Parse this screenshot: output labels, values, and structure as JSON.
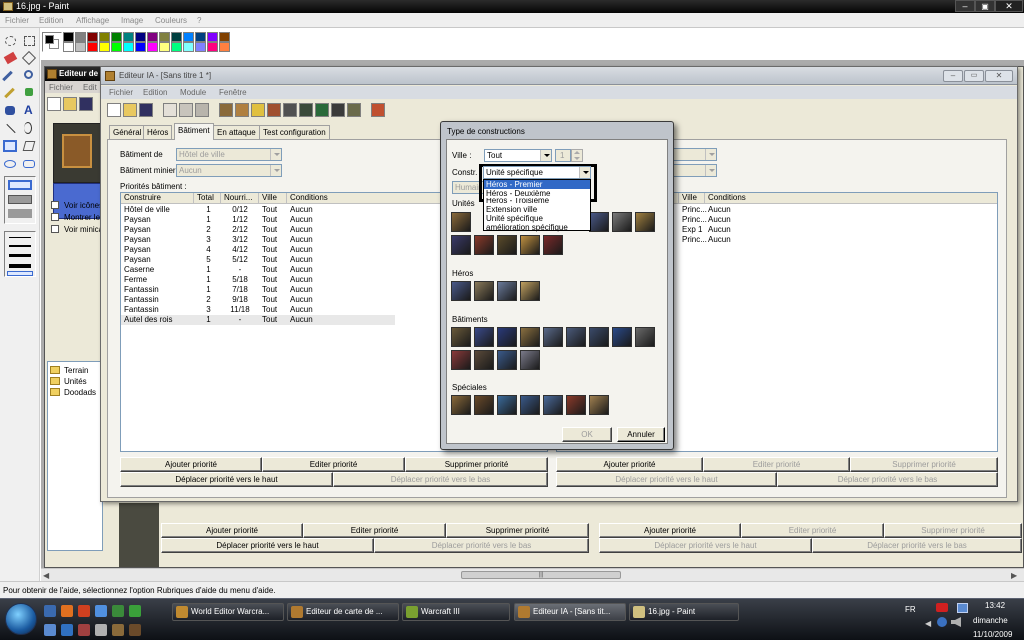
{
  "paint": {
    "title": "16.jpg - Paint",
    "menu": [
      "Fichier",
      "Edition",
      "Affichage",
      "Image",
      "Couleurs",
      "?"
    ],
    "status": "Pour obtenir de l'aide, sélectionnez l'option Rubriques d'aide du menu d'aide.",
    "palette_top": [
      "#000000",
      "#808080",
      "#800000",
      "#808000",
      "#008000",
      "#008080",
      "#000080",
      "#800080",
      "#808040",
      "#004040",
      "#0080ff",
      "#004080",
      "#8000ff",
      "#804000"
    ],
    "palette_bottom": [
      "#ffffff",
      "#c0c0c0",
      "#ff0000",
      "#ffff00",
      "#00ff00",
      "#00ffff",
      "#0000ff",
      "#ff00ff",
      "#ffff80",
      "#00ff80",
      "#80ffff",
      "#8080ff",
      "#ff0080",
      "#ff8040"
    ]
  },
  "editeur_bg": {
    "title": "Editeur de",
    "menu": [
      "Fichier",
      "Edit"
    ],
    "checks": [
      "Voir icônes",
      "Montrer les",
      "Voir minica"
    ],
    "tree": [
      "Terrain",
      "Unités",
      "Doodads"
    ],
    "buttons": {
      "add": "Ajouter priorité",
      "edit": "Editer priorité",
      "del": "Supprimer priorité",
      "up": "Déplacer priorité vers le haut",
      "down": "Déplacer priorité vers le bas"
    }
  },
  "editeur_ia": {
    "title": "Editeur IA - [Sans titre 1 *]",
    "menu": [
      "Fichier",
      "Edition",
      "Module",
      "Fenêtre"
    ],
    "tabs": [
      "Général",
      "Héros",
      "Bâtiment",
      "En attaque",
      "Test configuration"
    ],
    "batiment_de_label": "Bâtiment de",
    "batiment_de_value": "Hôtel de ville",
    "batiment_minier_label": "Bâtiment minier :",
    "batiment_minier_value": "Aucun",
    "priorites_label": "Priorités bâtiment :",
    "columns": [
      "Construire",
      "Total",
      "Nourri...",
      "Ville",
      "Conditions"
    ],
    "rows": [
      [
        "Hôtel de ville",
        "1",
        "0/12",
        "Tout",
        "Aucun"
      ],
      [
        "Paysan",
        "1",
        "1/12",
        "Tout",
        "Aucun"
      ],
      [
        "Paysan",
        "2",
        "2/12",
        "Tout",
        "Aucun"
      ],
      [
        "Paysan",
        "3",
        "3/12",
        "Tout",
        "Aucun"
      ],
      [
        "Paysan",
        "4",
        "4/12",
        "Tout",
        "Aucun"
      ],
      [
        "Paysan",
        "5",
        "5/12",
        "Tout",
        "Aucun"
      ],
      [
        "Caserne",
        "1",
        "-",
        "Tout",
        "Aucun"
      ],
      [
        "Ferme",
        "1",
        "5/18",
        "Tout",
        "Aucun"
      ],
      [
        "Fantassin",
        "1",
        "7/18",
        "Tout",
        "Aucun"
      ],
      [
        "Fantassin",
        "2",
        "9/18",
        "Tout",
        "Aucun"
      ],
      [
        "Fantassin",
        "3",
        "11/18",
        "Tout",
        "Aucun"
      ],
      [
        "Autel des rois",
        "1",
        "-",
        "Tout",
        "Aucun"
      ]
    ],
    "right_columns": [
      "Ville",
      "Conditions"
    ],
    "right_rows": [
      [
        "Princ...",
        "Aucun"
      ],
      [
        "Princ...",
        "Aucun"
      ],
      [
        "Exp 1",
        "Aucun"
      ],
      [
        "Princ...",
        "Aucun"
      ]
    ],
    "buttons": {
      "add": "Ajouter priorité",
      "edit": "Editer priorité",
      "del": "Supprimer priorité",
      "up": "Déplacer priorité vers le haut",
      "down": "Déplacer priorité vers le bas"
    }
  },
  "dialog": {
    "title": "Type de constructions",
    "ville_label": "Ville :",
    "ville_value": "Tout",
    "ville_num": "1",
    "constr_label": "Constr.",
    "constr_value": "Unité spécifique",
    "race_value": "Humain",
    "unites_label": "Unités",
    "dropdown": [
      "Héros - Premier",
      "Héros - Deuxième",
      "Héros - Troisième",
      "Extension ville",
      "Unité spécifique",
      "amélioration spécifique"
    ],
    "sections": {
      "heros": "Héros",
      "batiments": "Bâtiments",
      "speciales": "Spéciales"
    },
    "ok": "OK",
    "annuler": "Annuler",
    "unit_colors": [
      "#8a6a3a",
      "#4a5a8a",
      "#7a7a7a",
      "#a08040",
      "#3a3a6a",
      "#8a3a2a",
      "#5a4a2a",
      "#c09040",
      "#7a2a2a"
    ],
    "hero_colors": [
      "#4a5a8a",
      "#8a7a5a",
      "#6a7a9a",
      "#c0a060"
    ],
    "building_colors": [
      "#6a5a3a",
      "#3a4a8a",
      "#2a3a7a",
      "#8a7040",
      "#5a6a8a",
      "#4a5a7a",
      "#3a4a6a",
      "#2a4a8a",
      "#6a6a6a",
      "#8a3a3a",
      "#5a4a3a",
      "#3a5a8a",
      "#7a7a8a"
    ],
    "special_colors": [
      "#8a6a3a",
      "#6a4a2a",
      "#3a6a9a",
      "#3a5a8a",
      "#4a6a9a",
      "#8a3a2a",
      "#a08050"
    ]
  },
  "taskbar": {
    "tasks": [
      "World Editor Warcra...",
      "Editeur de carte de ...",
      "Warcraft III",
      "Editeur IA - [Sans tit...",
      "16.jpg - Paint"
    ],
    "lang": "FR",
    "time": "13:42",
    "day": "dimanche",
    "date": "11/10/2009"
  }
}
